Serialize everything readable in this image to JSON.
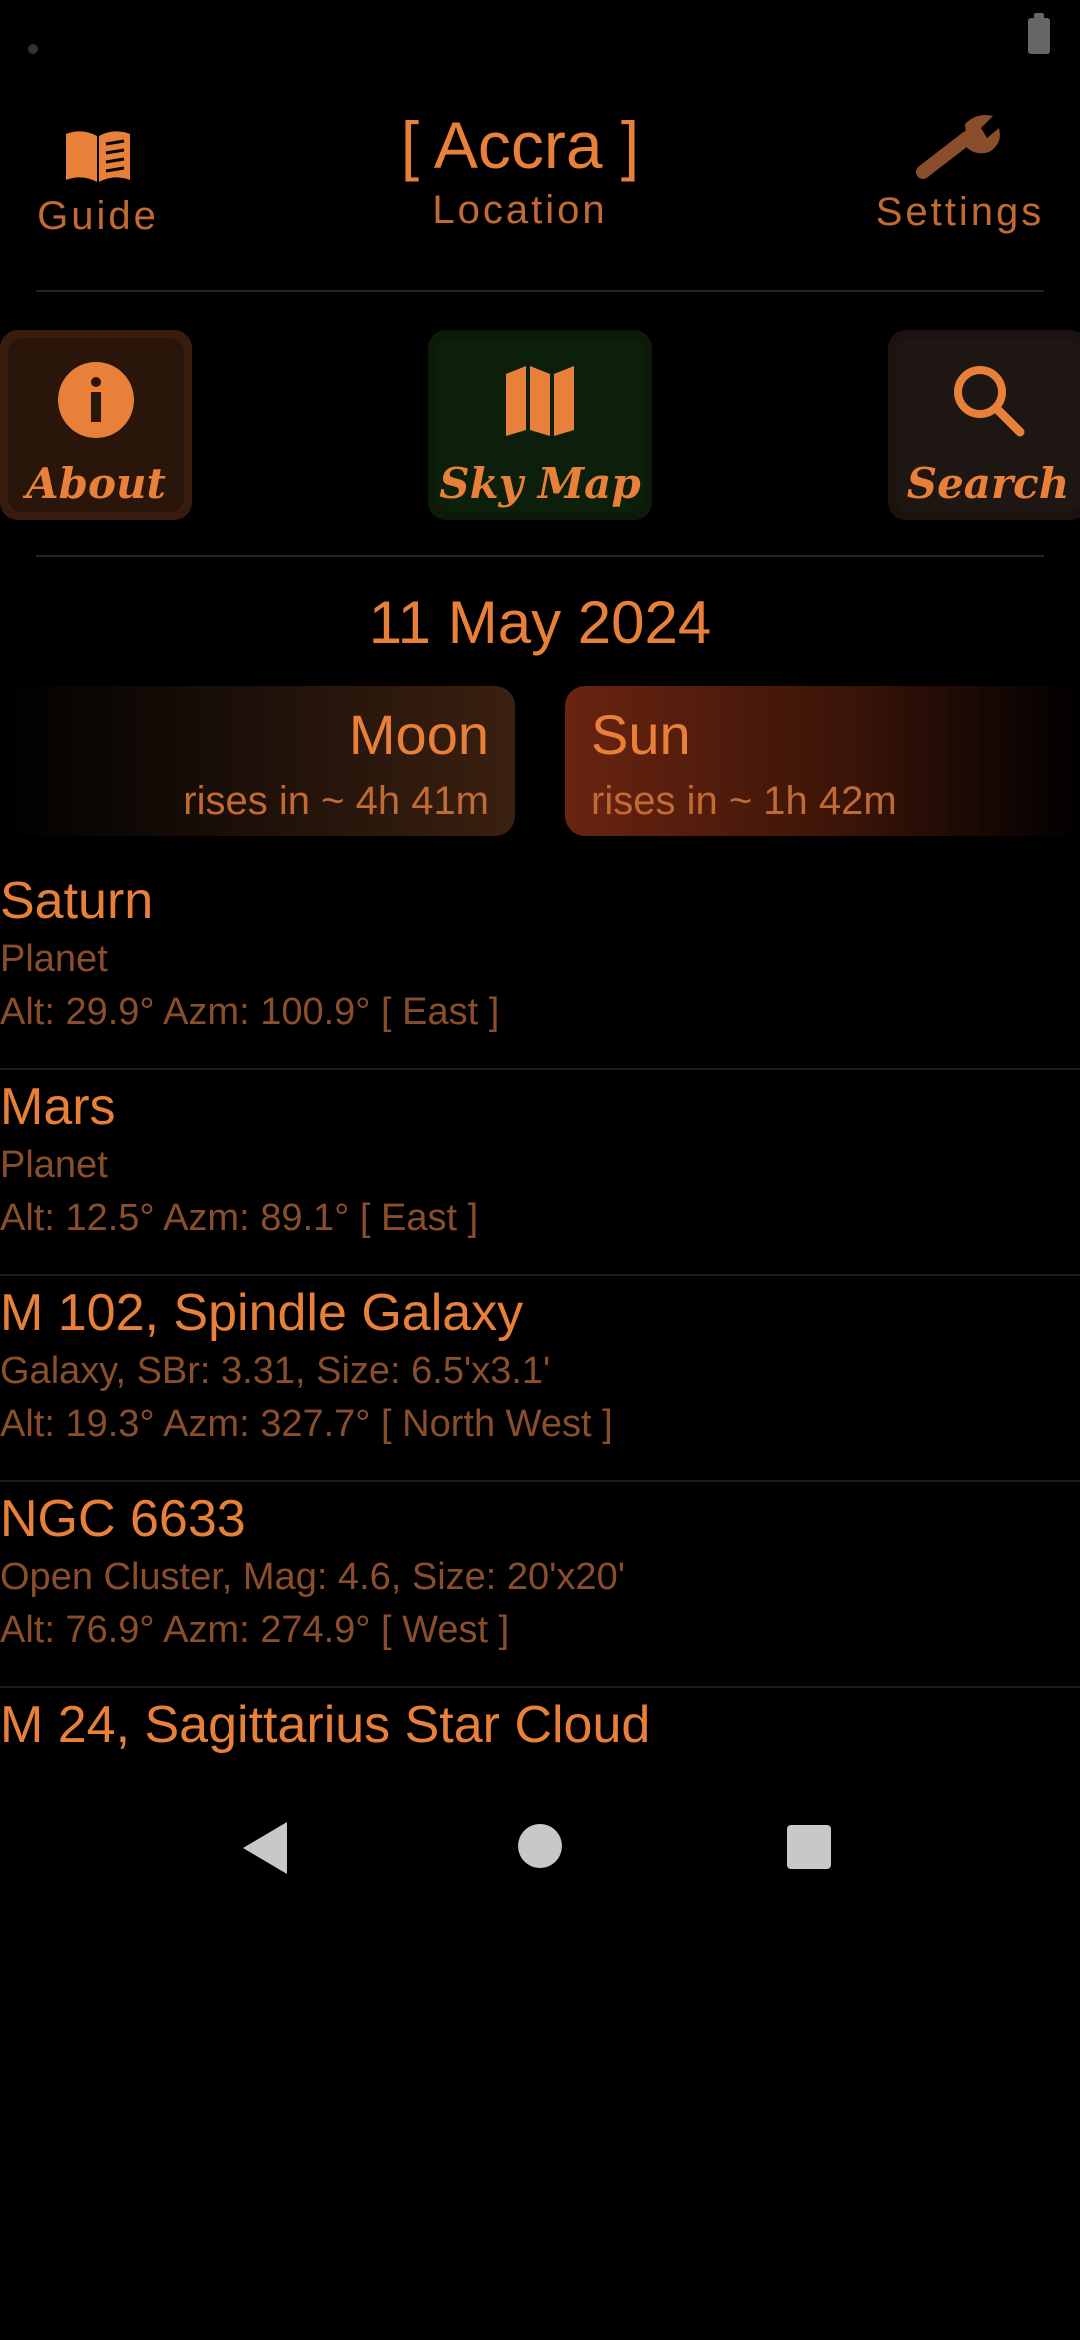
{
  "header": {
    "guide_label": "Guide",
    "location_title": "[ Accra ]",
    "location_label": "Location",
    "settings_label": "Settings"
  },
  "actions": {
    "about_label": "About",
    "skymap_label": "Sky Map",
    "search_label": "Search"
  },
  "date": "11 May 2024",
  "bodies": {
    "moon": {
      "name": "Moon",
      "status": "rises in ~ 4h 41m"
    },
    "sun": {
      "name": "Sun",
      "status": "rises in ~ 1h 42m"
    }
  },
  "objects": [
    {
      "name": "Saturn",
      "type": "Planet",
      "position": "Alt: 29.9° Azm: 100.9° [ East ]"
    },
    {
      "name": "Mars",
      "type": "Planet",
      "position": "Alt: 12.5° Azm: 89.1° [ East ]"
    },
    {
      "name": "M 102, Spindle Galaxy",
      "type": "Galaxy, SBr: 3.31, Size: 6.5'x3.1'",
      "position": "Alt: 19.3° Azm: 327.7° [ North West ]"
    },
    {
      "name": "NGC 6633",
      "type": "Open Cluster, Mag: 4.6, Size: 20'x20'",
      "position": "Alt: 76.9° Azm: 274.9° [ West ]"
    },
    {
      "name": "M 24, Sagittarius Star Cloud",
      "type": "",
      "position": ""
    }
  ],
  "colors": {
    "accent": "#e8803a",
    "muted": "#8a4e2c",
    "background": "#000000"
  },
  "icons": {
    "guide": "book-icon",
    "settings": "wrench-icon",
    "about": "info-icon",
    "skymap": "map-icon",
    "search": "search-icon"
  }
}
